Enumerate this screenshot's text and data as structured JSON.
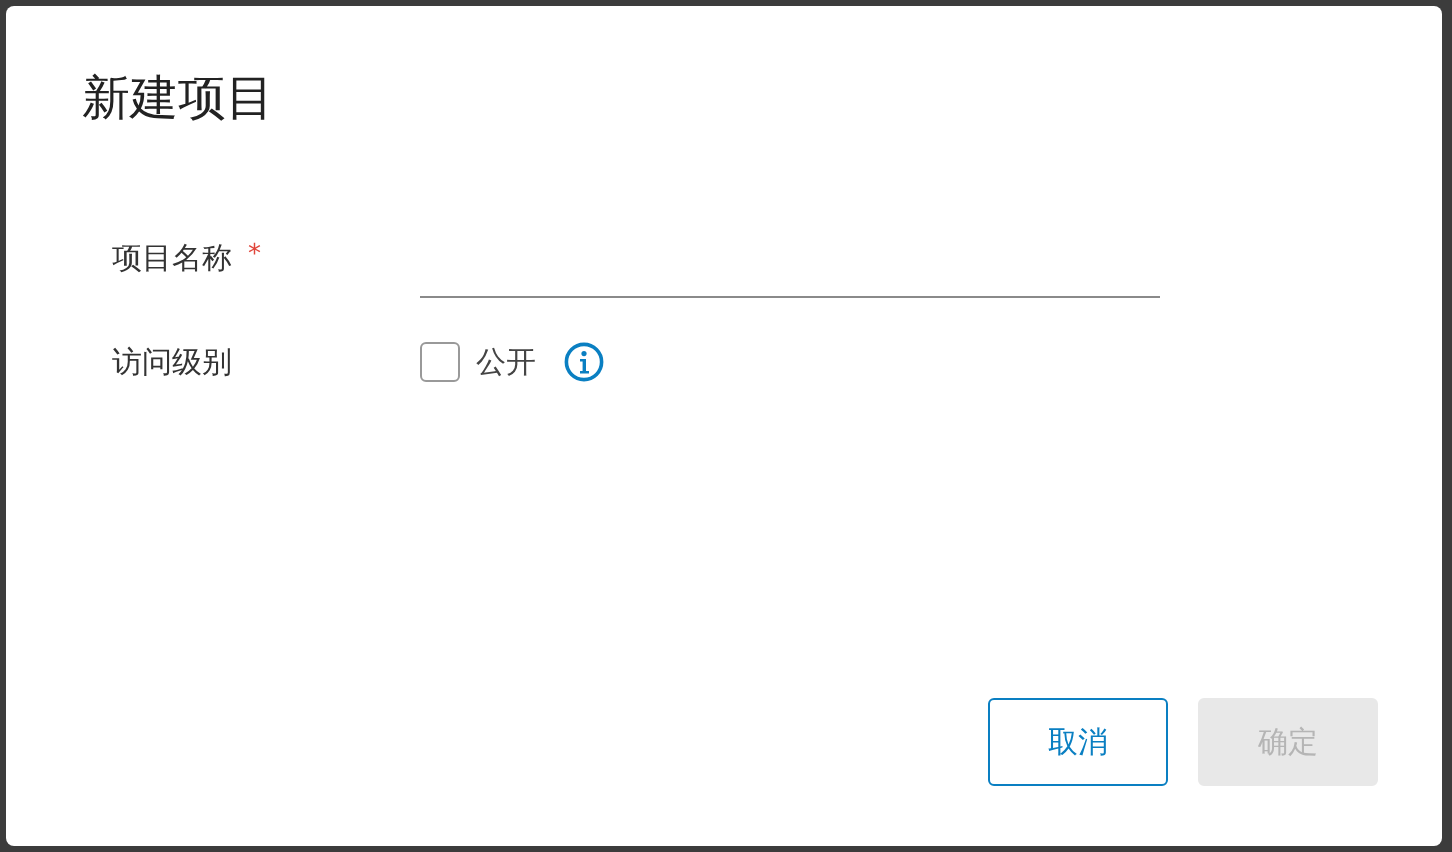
{
  "dialog": {
    "title": "新建项目"
  },
  "fields": [
    {
      "kind": "text",
      "label": "项目名称",
      "required": true,
      "required_mark": "*"
    },
    {
      "kind": "checkbox",
      "label": "访问级别",
      "option": "公开",
      "checked": false
    }
  ],
  "buttons": [
    {
      "label": "取消",
      "disabled": false,
      "kind": "secondary"
    },
    {
      "label": "确定",
      "disabled": true,
      "kind": "primary"
    }
  ]
}
